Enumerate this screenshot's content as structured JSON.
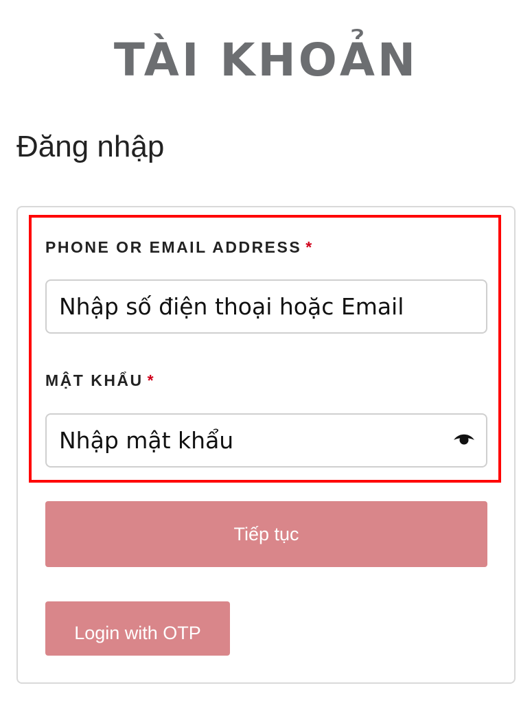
{
  "header": {
    "title": "TÀI KHOẢN"
  },
  "login": {
    "title": "Đăng nhập",
    "phone_label": "PHONE OR EMAIL ADDRESS",
    "phone_required": "*",
    "phone_placeholder": "Nhập số điện thoại hoặc Email",
    "password_label": "MẬT KHẨU",
    "password_required": "*",
    "password_placeholder": "Nhập mật khẩu",
    "password_toggle_icon": "eye-icon",
    "continue_button": "Tiếp tục",
    "otp_button": "Login with OTP"
  },
  "colors": {
    "header_text": "#6c6e71",
    "button_bg": "#d9868a",
    "required_star": "#d0021b",
    "highlight_border": "#ff0000"
  }
}
